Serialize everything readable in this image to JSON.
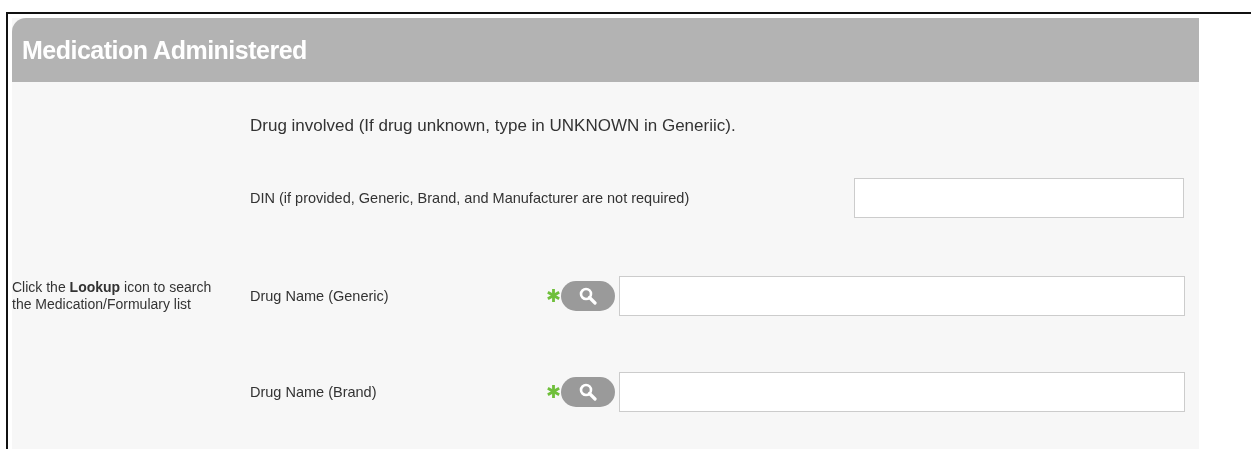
{
  "section": {
    "title": "Medication Administered"
  },
  "intro": "Drug involved (If drug unknown, type in UNKNOWN in Generiic).",
  "hint": "Click the **Lookup** icon to search the Medication/Formulary list",
  "fields": [
    {
      "kind": "text",
      "label": "DIN (if provided, Generic, Brand, and Manufacturer are not required)",
      "required": false
    },
    {
      "kind": "lookup",
      "label": "Drug Name (Generic)",
      "required": true
    },
    {
      "kind": "lookup",
      "label": "Drug Name (Brand)",
      "required": true
    }
  ]
}
